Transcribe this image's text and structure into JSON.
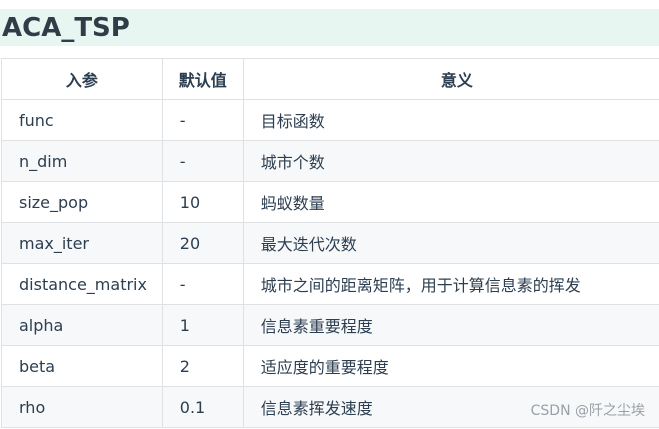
{
  "heading": "ACA_TSP",
  "table": {
    "headers": [
      "入参",
      "默认值",
      "意义"
    ],
    "rows": [
      [
        "func",
        "-",
        "目标函数"
      ],
      [
        "n_dim",
        "-",
        "城市个数"
      ],
      [
        "size_pop",
        "10",
        "蚂蚁数量"
      ],
      [
        "max_iter",
        "20",
        "最大迭代次数"
      ],
      [
        "distance_matrix",
        "-",
        "城市之间的距离矩阵，用于计算信息素的挥发"
      ],
      [
        "alpha",
        "1",
        "信息素重要程度"
      ],
      [
        "beta",
        "2",
        "适应度的重要程度"
      ],
      [
        "rho",
        "0.1",
        "信息素挥发速度"
      ]
    ]
  },
  "watermark": "CSDN @阡之尘埃"
}
